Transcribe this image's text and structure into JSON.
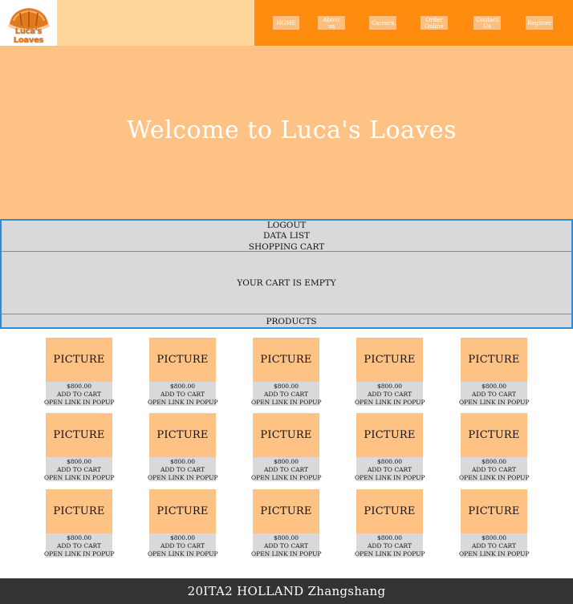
{
  "header": {
    "logo": {
      "text": "Luca's Loaves",
      "icon": "bread-logo"
    },
    "nav": [
      {
        "label": "HOME"
      },
      {
        "label": "About us"
      },
      {
        "label": "Careers"
      },
      {
        "label": "Order Online"
      },
      {
        "label": "Contact Us"
      },
      {
        "label": "Register"
      }
    ]
  },
  "hero": {
    "title": "Welcome to Luca's Loaves"
  },
  "user_panel": {
    "links": [
      {
        "label": "LOGOUT"
      },
      {
        "label": "DATA LIST"
      },
      {
        "label": "SHOPPING CART"
      }
    ],
    "cart_status": "YOUR CART IS EMPTY",
    "products_label": "PRODUCTS"
  },
  "products": [
    {
      "picture": "PICTURE",
      "price": "$800.00",
      "add": "ADD TO CART",
      "open": "OPEN LINK IN POPUP"
    },
    {
      "picture": "PICTURE",
      "price": "$800.00",
      "add": "ADD TO CART",
      "open": "OPEN LINK IN POPUP"
    },
    {
      "picture": "PICTURE",
      "price": "$800.00",
      "add": "ADD TO CART",
      "open": "OPEN LINK IN POPUP"
    },
    {
      "picture": "PICTURE",
      "price": "$800.00",
      "add": "ADD TO CART",
      "open": "OPEN LINK IN POPUP"
    },
    {
      "picture": "PICTURE",
      "price": "$800.00",
      "add": "ADD TO CART",
      "open": "OPEN LINK IN POPUP"
    },
    {
      "picture": "PICTURE",
      "price": "$800.00",
      "add": "ADD TO CART",
      "open": "OPEN LINK IN POPUP"
    },
    {
      "picture": "PICTURE",
      "price": "$800.00",
      "add": "ADD TO CART",
      "open": "OPEN LINK IN POPUP"
    },
    {
      "picture": "PICTURE",
      "price": "$800.00",
      "add": "ADD TO CART",
      "open": "OPEN LINK IN POPUP"
    },
    {
      "picture": "PICTURE",
      "price": "$800.00",
      "add": "ADD TO CART",
      "open": "OPEN LINK IN POPUP"
    },
    {
      "picture": "PICTURE",
      "price": "$800.00",
      "add": "ADD TO CART",
      "open": "OPEN LINK IN POPUP"
    },
    {
      "picture": "PICTURE",
      "price": "$800.00",
      "add": "ADD TO CART",
      "open": "OPEN LINK IN POPUP"
    },
    {
      "picture": "PICTURE",
      "price": "$800.00",
      "add": "ADD TO CART",
      "open": "OPEN LINK IN POPUP"
    },
    {
      "picture": "PICTURE",
      "price": "$800.00",
      "add": "ADD TO CART",
      "open": "OPEN LINK IN POPUP"
    },
    {
      "picture": "PICTURE",
      "price": "$800.00",
      "add": "ADD TO CART",
      "open": "OPEN LINK IN POPUP"
    },
    {
      "picture": "PICTURE",
      "price": "$800.00",
      "add": "ADD TO CART",
      "open": "OPEN LINK IN POPUP"
    }
  ],
  "footer": {
    "text": "20ITA2 HOLLAND Zhangshang"
  },
  "colors": {
    "header_left": "#ffd79a",
    "header_right": "#ff8c0f",
    "hero_bg": "#ffc285",
    "panel_bg": "#d9d9d9",
    "panel_border": "#2f8bd9",
    "footer_bg": "#333333"
  }
}
